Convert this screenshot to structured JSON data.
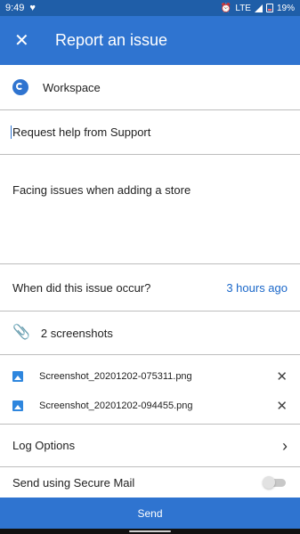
{
  "status_bar": {
    "time": "9:49",
    "network": "LTE",
    "battery": "19%"
  },
  "app_bar": {
    "title": "Report an issue"
  },
  "workspace": {
    "label": "Workspace"
  },
  "subject": {
    "value": "Request help from Support"
  },
  "description": {
    "value": "Facing issues when adding a store"
  },
  "occurrence": {
    "question": "When did this issue occur?",
    "value": "3 hours ago"
  },
  "attachments": {
    "summary": "2 screenshots",
    "files": [
      {
        "name": "Screenshot_20201202-075311.png"
      },
      {
        "name": "Screenshot_20201202-094455.png"
      }
    ]
  },
  "log_options": {
    "label": "Log Options"
  },
  "secure_mail": {
    "label": "Send using Secure Mail",
    "enabled": false
  },
  "send": {
    "label": "Send"
  },
  "colors": {
    "primary": "#2f74d0",
    "status_bar": "#1f5ea8",
    "link": "#1a67c9"
  }
}
